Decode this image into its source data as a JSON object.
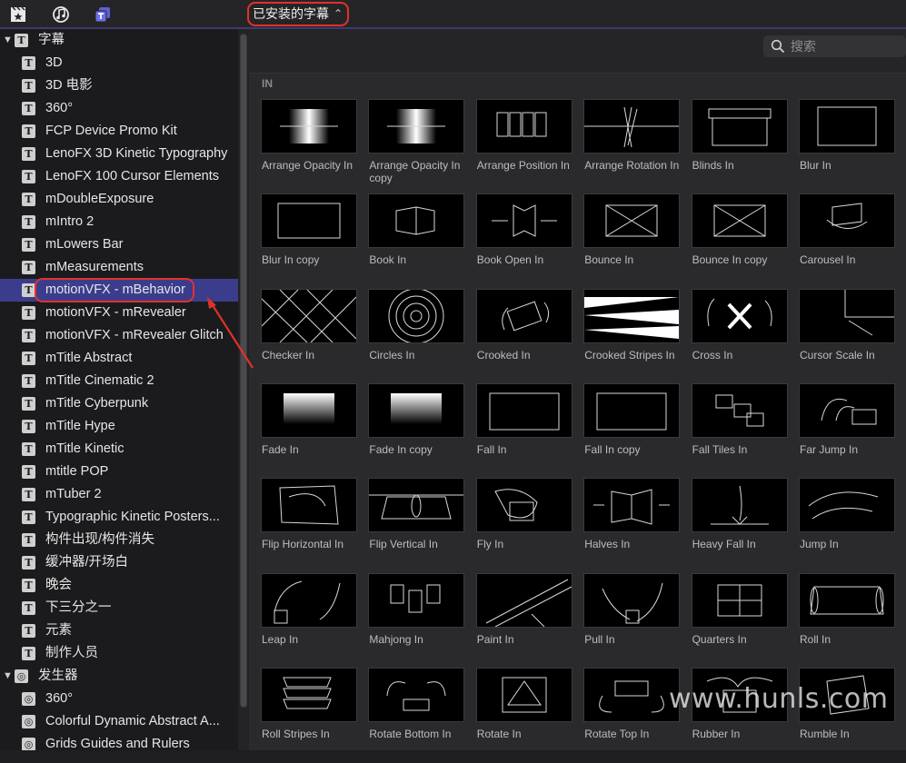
{
  "toolbar": {
    "icons": [
      "clapper-star-icon",
      "music-notes-icon",
      "titles-icon"
    ],
    "dropdown_label": "已安装的字幕",
    "dropdown_chevron": "⌃⌄"
  },
  "sidebar": {
    "rows": [
      {
        "label": "字幕",
        "type": "group",
        "icon": "T"
      },
      {
        "label": "3D",
        "icon": "T"
      },
      {
        "label": "3D 电影",
        "icon": "T"
      },
      {
        "label": "360°",
        "icon": "T"
      },
      {
        "label": "FCP Device Promo Kit",
        "icon": "T"
      },
      {
        "label": "LenoFX 3D Kinetic Typography",
        "icon": "T"
      },
      {
        "label": "LenoFX 100 Cursor Elements",
        "icon": "T"
      },
      {
        "label": "mDoubleExposure",
        "icon": "T"
      },
      {
        "label": "mIntro 2",
        "icon": "T"
      },
      {
        "label": "mLowers Bar",
        "icon": "T"
      },
      {
        "label": "mMeasurements",
        "icon": "T"
      },
      {
        "label": "motionVFX - mBehavior",
        "icon": "T",
        "selected": true
      },
      {
        "label": "motionVFX - mRevealer",
        "icon": "T"
      },
      {
        "label": "motionVFX - mRevealer Glitch",
        "icon": "T"
      },
      {
        "label": "mTitle Abstract",
        "icon": "T"
      },
      {
        "label": "mTitle Cinematic 2",
        "icon": "T"
      },
      {
        "label": "mTitle Cyberpunk",
        "icon": "T"
      },
      {
        "label": "mTitle Hype",
        "icon": "T"
      },
      {
        "label": "mTitle Kinetic",
        "icon": "T"
      },
      {
        "label": "mtitle POP",
        "icon": "T"
      },
      {
        "label": "mTuber 2",
        "icon": "T"
      },
      {
        "label": "Typographic Kinetic Posters...",
        "icon": "T"
      },
      {
        "label": "构件出现/构件消失",
        "icon": "T"
      },
      {
        "label": "缓冲器/开场白",
        "icon": "T"
      },
      {
        "label": "晚会",
        "icon": "T"
      },
      {
        "label": "下三分之一",
        "icon": "T"
      },
      {
        "label": "元素",
        "icon": "T"
      },
      {
        "label": "制作人员",
        "icon": "T"
      },
      {
        "label": "发生器",
        "type": "group",
        "icon": "◎"
      },
      {
        "label": "360°",
        "icon": "◎"
      },
      {
        "label": "Colorful Dynamic Abstract A...",
        "icon": "◎"
      },
      {
        "label": "Grids Guides and Rulers",
        "icon": "◎"
      }
    ]
  },
  "search": {
    "placeholder": "搜索"
  },
  "section_title": "IN",
  "tiles": [
    "Arrange Opacity In",
    "Arrange Opacity In copy",
    "Arrange Position In",
    "Arrange Rotation In",
    "Blinds In",
    "Blur In",
    "Blur In copy",
    "Book In",
    "Book Open In",
    "Bounce In",
    "Bounce In copy",
    "Carousel In",
    "Checker In",
    "Circles In",
    "Crooked In",
    "Crooked Stripes In",
    "Cross In",
    "Cursor Scale In",
    "Fade In",
    "Fade In copy",
    "Fall In",
    "Fall In copy",
    "Fall Tiles In",
    "Far Jump In",
    "Flip Horizontal In",
    "Flip Vertical In",
    "Fly In",
    "Halves In",
    "Heavy Fall In",
    "Jump In",
    "Leap In",
    "Mahjong In",
    "Paint In",
    "Pull In",
    "Quarters In",
    "Roll In",
    "Roll Stripes In",
    "Rotate Bottom In",
    "Rotate In",
    "Rotate Top In",
    "Rubber In",
    "Rumble In"
  ],
  "watermark": "www.hunls.com",
  "colors": {
    "accent": "#3b3d8c",
    "highlight": "#e0322a",
    "annotation_arrow": "#e0322a"
  }
}
